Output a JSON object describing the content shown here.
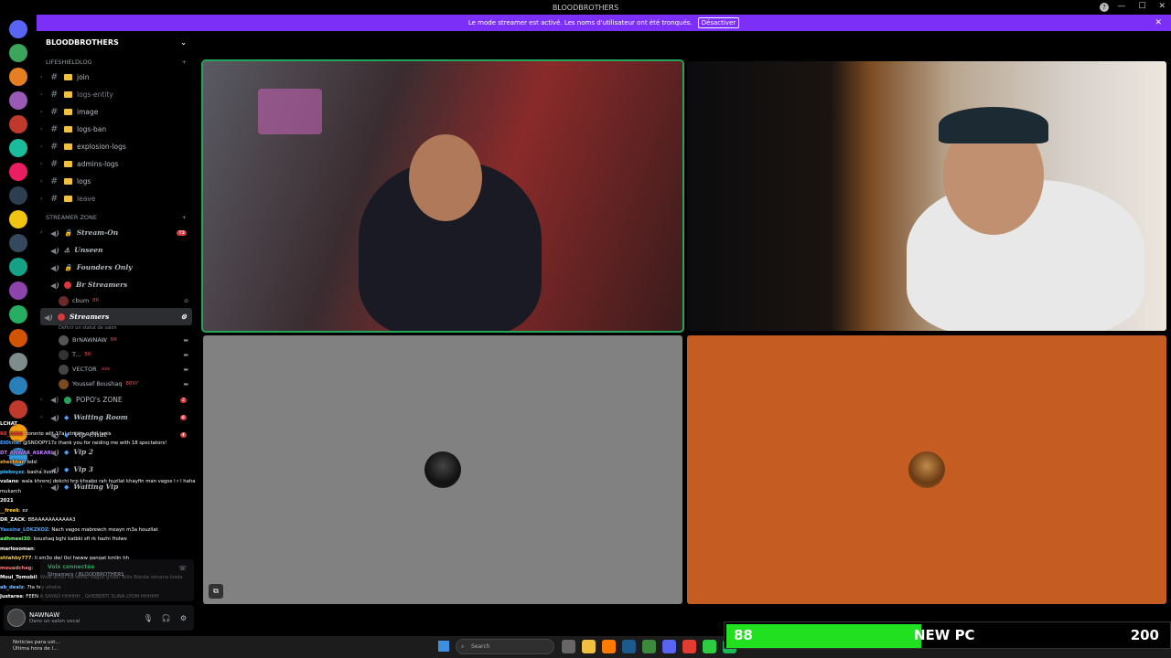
{
  "window": {
    "title": "BLOODBROTHERS"
  },
  "banner": {
    "text": "Le mode streamer est activé. Les noms d'utilisateur ont été tronqués.",
    "button": "Désactiver"
  },
  "server": {
    "name": "BLOODBROTHERS"
  },
  "categories": [
    {
      "name": "LIFESHIELDLOG",
      "channels": [
        "join",
        "logs-entity",
        "image",
        "logs-ban",
        "explosion-logs",
        "admins-logs",
        "logs",
        "leave"
      ]
    },
    {
      "name": "STREAMER ZONE"
    }
  ],
  "voice_channels": [
    {
      "name": "Stream-On",
      "count": "75"
    },
    {
      "name": "Unseen"
    },
    {
      "name": "Founders Only"
    },
    {
      "name": "Br Streamers"
    },
    {
      "name": "Streamers"
    },
    {
      "name": "POPO's ZONE",
      "count": "2"
    },
    {
      "name": "Waiting Room",
      "count": "6"
    },
    {
      "name": "Vip-Chat",
      "count": "4"
    },
    {
      "name": "Vip 2"
    },
    {
      "name": "Vip 3"
    },
    {
      "name": "Waiting Vip"
    }
  ],
  "br_streamer_user": {
    "name": "cbum",
    "tag": "BR"
  },
  "streamers_status": "Définir un statut de salon",
  "streamers_users": [
    {
      "name": "BrNAWNAW",
      "tag": "BR"
    },
    {
      "name": "T...",
      "tag": "BR"
    },
    {
      "name": "VECTOR",
      "tag": ".exe"
    },
    {
      "name": "Youssef Boushaq",
      "tag": "BBNY"
    }
  ],
  "voice_panel": {
    "status": "Voix connectée",
    "channel": "Streamers / BLOODBROTHERS"
  },
  "user": {
    "name": "NAWNAW",
    "status": "Dans un salon vocal"
  },
  "chat": [
    {
      "name": "LCHAT",
      "msg": ""
    },
    {
      "name": "RE_mmo",
      "msg": ": toronto wlit 17al stream o del tanis"
    },
    {
      "name": "ElOtnik",
      "msg": ": @SNOOPY17z thank you for raiding me with 18 spectators!"
    },
    {
      "name": "DT_ANWAR_ASKARI",
      "msg": ":"
    },
    {
      "name": "shechtar",
      "msg": ": bdsl"
    },
    {
      "name": "pieboyzz",
      "msg": ": basha liveri"
    },
    {
      "name": "vulano",
      "msg": ": wala khrerej dekchi hrp khsabo rah huzllat khayfin man vagos l r l hahaha rah howa mukarch"
    },
    {
      "name": "2021",
      "msg": ""
    },
    {
      "name": "__freek",
      "msg": ": ez"
    },
    {
      "name": "DR_ZACK",
      "msg": ": BBAAAAAAAAAAA3"
    },
    {
      "name": "Yassine_LOKZKOZ",
      "msg": ": Nach vagos mabrewch meayn m3a houzllat"
    },
    {
      "name": "adhmeel30",
      "msg": ": boushaq bghi katbki sfi rk hazhi Holwe"
    },
    {
      "name": "marlosoman",
      "msg": ":"
    },
    {
      "name": "shlahby777",
      "msg": ": li sm3o dw/ 0ol hwww gangat kmlin hh"
    },
    {
      "name": "mouadcheg",
      "msg": ":"
    },
    {
      "name": "Moul_Tomobil",
      "msg": ": Wsld achki tla dkhal Vagos ghadi Yolio Bonda simana lowla"
    },
    {
      "name": "ab_dealz",
      "msg": ": 7ta hry ahaha"
    },
    {
      "name": "Justaree",
      "msg": ": FEEN A SAYAD HHHHH , GHEBERTI 3LINA LYOM HHHHH"
    }
  ],
  "taskbar": {
    "news_title": "Noticias para ust...",
    "news_sub": "Última hora de l...",
    "search_placeholder": "Search"
  },
  "counter": {
    "current": "88",
    "label": "NEW PC",
    "goal": "200",
    "fraction": 0.44
  },
  "colors": {
    "accent": "#7b2ff7",
    "speaking": "#23a55a",
    "counter_fill": "#20e020"
  }
}
